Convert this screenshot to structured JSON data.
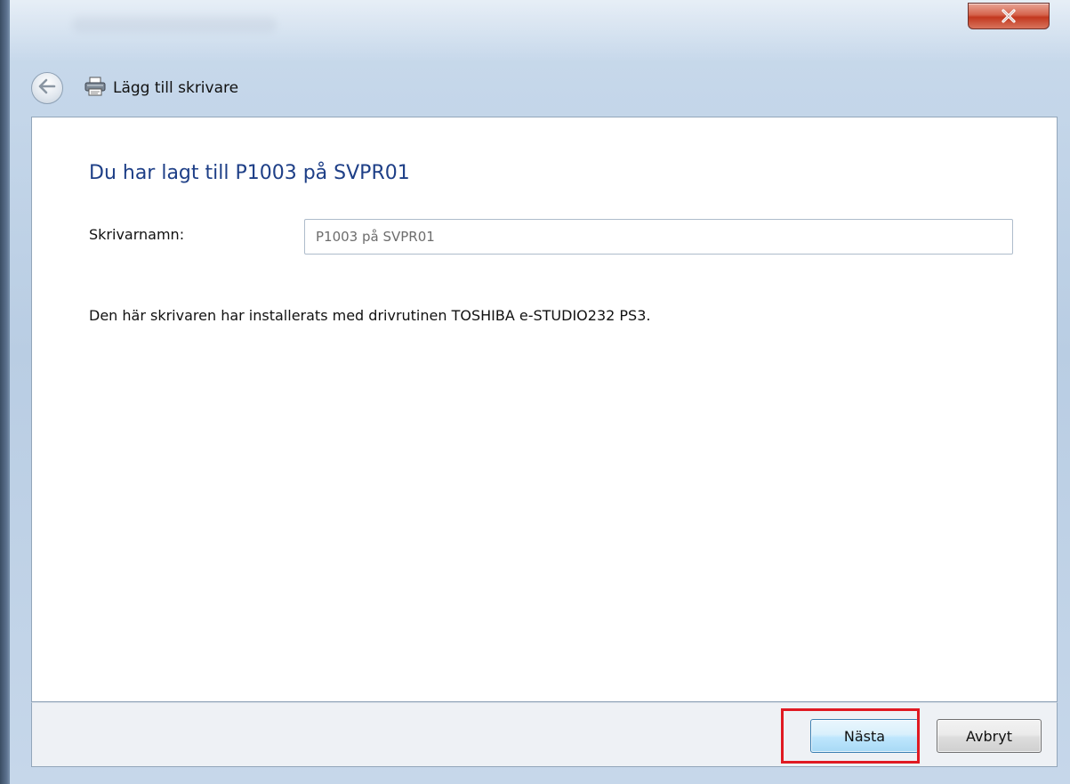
{
  "window": {
    "nav_title": "Lägg till skrivare",
    "close_icon": "close-x-icon",
    "back_icon": "back-arrow-icon",
    "printer_icon": "printer-icon",
    "accent": "#1e3f87",
    "close_color": "#c2381f"
  },
  "main": {
    "heading": "Du har lagt till P1003 på SVPR01",
    "printer_name_label": "Skrivarnamn:",
    "printer_name_value": "P1003 på SVPR01",
    "driver_text": "Den här skrivaren har installerats med drivrutinen TOSHIBA e-STUDIO232 PS3."
  },
  "footer": {
    "next_label": "Nästa",
    "cancel_label": "Avbryt",
    "highlight_color": "#e01a22"
  }
}
